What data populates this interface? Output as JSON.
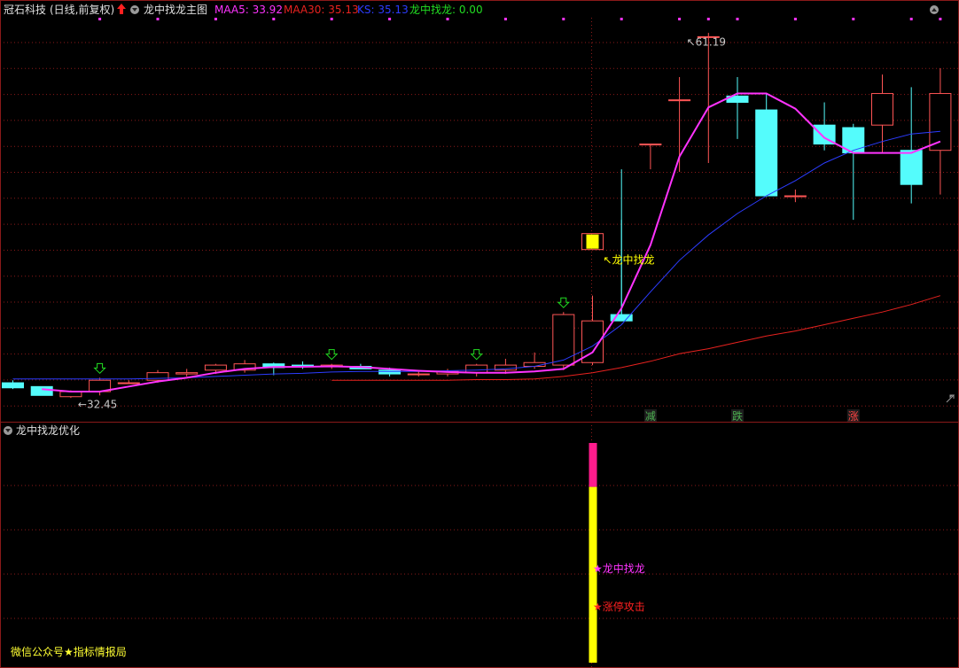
{
  "header": {
    "stock_name": "冠石科技",
    "period": "(日线,前复权)",
    "indicator_name": "龙中找龙主图",
    "maa5": "MAA5: 33.92",
    "maa30": "MAA30: 35.13",
    "ks": "KS: 35.13",
    "lzl": "龙中找龙: 0.00"
  },
  "sub_panel": {
    "title": "龙中找龙优化",
    "label_lzl": "★龙中找龙",
    "label_zt": "★涨停攻击",
    "footer": "微信公众号★指标情报局",
    "bar_top_value": 1.0,
    "bar_split_value": 0.8
  },
  "colors": {
    "up": "#ff5555",
    "down": "#54fcfc",
    "ma5": "#ff33ff",
    "ks": "#2c3cff",
    "ma30": "#e8221f",
    "signal": "#ffff00",
    "grid": "#8b1a1a",
    "text_gray": "#c8c8c8"
  },
  "chart_data": {
    "type": "candlestick",
    "x": [
      0,
      1,
      2,
      3,
      4,
      5,
      6,
      7,
      8,
      9,
      10,
      11,
      12,
      13,
      14,
      15,
      16,
      17,
      18,
      19,
      20,
      21,
      22,
      23,
      24,
      25,
      26,
      27,
      28,
      29,
      30,
      31,
      32
    ],
    "open": [
      33.6,
      33.3,
      32.5,
      32.9,
      33.6,
      33.8,
      34.3,
      34.6,
      34.6,
      35.1,
      35.0,
      34.9,
      34.9,
      34.6,
      34.3,
      34.3,
      34.4,
      34.6,
      34.9,
      35.0,
      35.2,
      39.0,
      52.5,
      56.0,
      61.0,
      56.3,
      55.2,
      48.4,
      54.0,
      53.8,
      54.0,
      52.0,
      52.0
    ],
    "close": [
      33.2,
      32.6,
      32.9,
      33.8,
      33.6,
      34.4,
      34.4,
      35.0,
      35.1,
      34.8,
      34.9,
      35.0,
      34.7,
      34.3,
      34.3,
      34.5,
      35.0,
      35.0,
      35.2,
      39.0,
      38.5,
      38.5,
      52.5,
      56.0,
      61.0,
      55.8,
      48.4,
      48.4,
      52.5,
      51.8,
      56.5,
      49.3,
      56.5
    ],
    "high": [
      33.8,
      33.3,
      33.0,
      34.0,
      33.8,
      34.6,
      34.7,
      35.1,
      35.4,
      35.2,
      35.3,
      35.1,
      35.1,
      34.8,
      34.6,
      34.7,
      35.1,
      35.5,
      36.0,
      39.2,
      40.5,
      50.5,
      52.5,
      57.8,
      61.3,
      57.8,
      56.5,
      48.9,
      55.8,
      54.1,
      58.0,
      57.0,
      58.5
    ],
    "low": [
      33.1,
      32.6,
      32.4,
      32.6,
      33.5,
      33.6,
      34.1,
      34.3,
      34.4,
      34.2,
      34.7,
      34.7,
      34.7,
      34.1,
      34.1,
      34.1,
      34.1,
      34.3,
      34.7,
      34.6,
      35.0,
      46.5,
      50.5,
      50.3,
      51.0,
      52.9,
      48.3,
      47.9,
      52.0,
      46.5,
      51.8,
      47.8,
      48.5
    ],
    "ma5": [
      null,
      33.1,
      32.9,
      32.9,
      33.3,
      33.7,
      34.0,
      34.4,
      34.7,
      34.85,
      34.87,
      34.9,
      34.85,
      34.7,
      34.55,
      34.45,
      34.4,
      34.4,
      34.5,
      34.7,
      36.0,
      39.5,
      44.5,
      51.5,
      55.4,
      56.5,
      56.5,
      55.3,
      53.0,
      51.8,
      51.8,
      51.8,
      52.7
    ],
    "ks": [
      33.9,
      33.9,
      33.9,
      33.9,
      33.9,
      33.95,
      34.0,
      34.1,
      34.2,
      34.3,
      34.35,
      34.45,
      34.5,
      34.5,
      34.5,
      34.55,
      34.6,
      34.7,
      34.9,
      35.4,
      36.5,
      38.2,
      40.8,
      43.3,
      45.3,
      47.0,
      48.4,
      49.6,
      51.0,
      52.0,
      52.7,
      53.3,
      53.5
    ],
    "ma30": [
      null,
      null,
      null,
      null,
      null,
      null,
      null,
      null,
      null,
      null,
      null,
      33.8,
      33.8,
      33.8,
      33.8,
      33.8,
      33.85,
      33.85,
      33.9,
      34.1,
      34.4,
      34.8,
      35.3,
      35.9,
      36.3,
      36.8,
      37.3,
      37.7,
      38.2,
      38.7,
      39.2,
      39.8,
      40.5
    ],
    "signal_arrows_at": [
      3,
      11,
      16,
      19
    ],
    "signal_box_at": 20,
    "signal_box_label": "龙中找龙",
    "dots_at": [
      3,
      5,
      7,
      9,
      11,
      13,
      15,
      17,
      19,
      21,
      23,
      24,
      25,
      27,
      29,
      31,
      32
    ],
    "bottom_markers": [
      {
        "index": 22,
        "text": "减",
        "color": "#4caf50"
      },
      {
        "index": 25,
        "text": "跌",
        "color": "#4caf50"
      },
      {
        "index": 29,
        "text": "涨",
        "color": "#ff4444"
      }
    ],
    "max_label": "61.19",
    "max_index": 23,
    "min_label": "32.45",
    "min_index": 2,
    "ylim": [
      31.5,
      62.5
    ],
    "sub_bar_index": 20
  }
}
